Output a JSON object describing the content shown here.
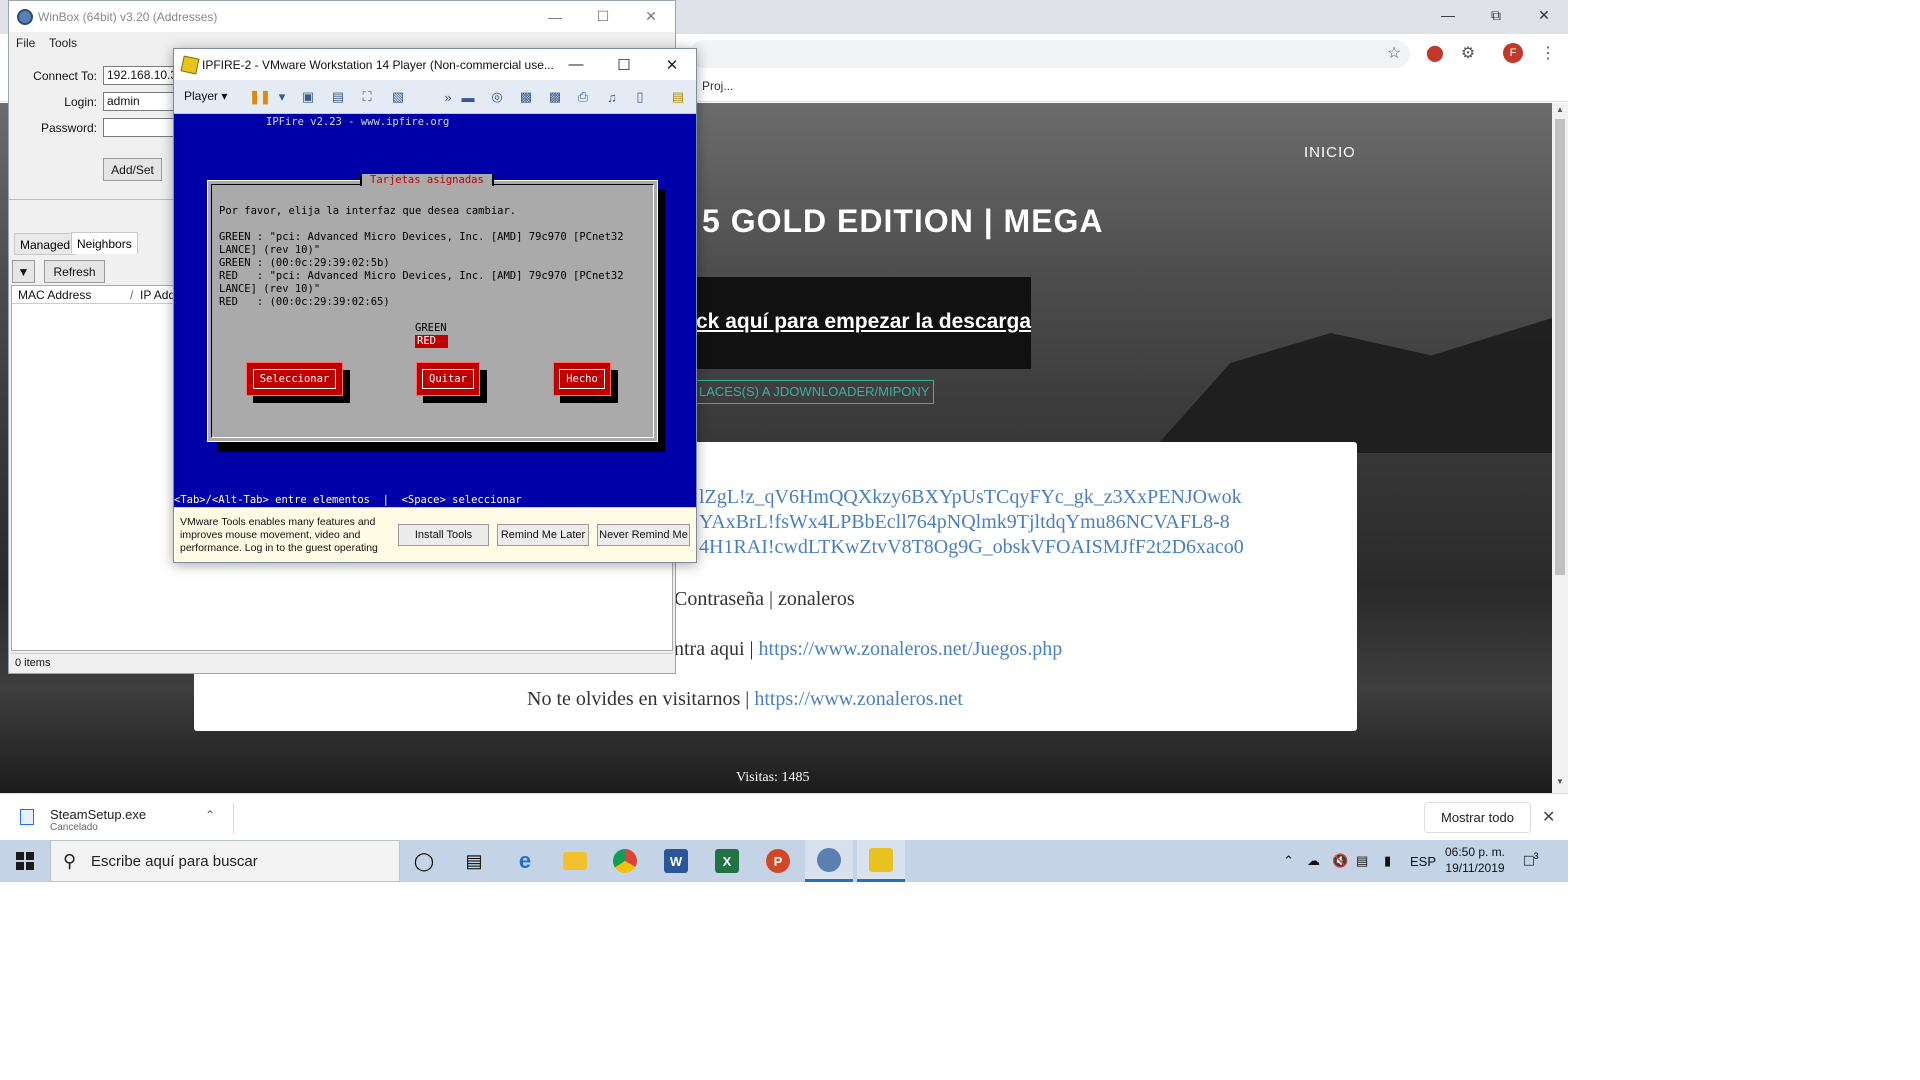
{
  "chrome": {
    "bookmark_label": "Proj...",
    "avatar_letter": "F",
    "ext_badge": "1",
    "page": {
      "nav_inicio": "INICIO",
      "title": "5 GOLD EDITION | MEGA",
      "download_button": "ck aquí para empezar la descarga",
      "enlaces_button": "LACES(S) A JDOWNLOADER/MIPONY",
      "links": [
        "lZgL!z_qV6HmQQXkzy6BXYpUsTCqyFYc_gk_z3XxPENJOwok",
        "YAxBrL!fsWx4LPBbEcll764pNQlmk9TjltdqYmu86NCVAFL8-8",
        "4H1RAI!cwdLTKwZtvV8T8Og9G_obskVFOAISMJfF2t2D6xaco0"
      ],
      "password_text": "Contraseña | zonaleros",
      "entra_prefix": "ntra aqui | ",
      "entra_link": "https://www.zonaleros.net/Juegos.php",
      "visit_prefix": "No te olvides en visitarnos | ",
      "visit_link": "https://www.zonaleros.net",
      "visitas": "Visitas: 1485"
    },
    "downloads": {
      "file_name": "SteamSetup.exe",
      "status": "Cancelado",
      "show_all": "Mostrar todo"
    }
  },
  "winbox": {
    "title": "WinBox (64bit) v3.20 (Addresses)",
    "menu": [
      "File",
      "Tools"
    ],
    "connect_to_label": "Connect To:",
    "connect_to_value": "192.168.10.3",
    "login_label": "Login:",
    "login_value": "admin",
    "password_label": "Password:",
    "password_value": "",
    "add_set_button": "Add/Set",
    "tabs": [
      "Managed",
      "Neighbors"
    ],
    "refresh_button": "Refresh",
    "columns": [
      "MAC Address",
      "IP Add"
    ],
    "status": "0 items"
  },
  "vmware": {
    "title": "IPFIRE-2 - VMware Workstation 14 Player (Non-commercial use...",
    "player_menu": "Player",
    "console": {
      "header": "IPFire v2.23 - www.ipfire.org",
      "dialog_title": "Tarjetas asignadas",
      "prompt": "Por favor, elija la interfaz que desea cambiar.",
      "lines": [
        "GREEN : \"pci: Advanced Micro Devices, Inc. [AMD] 79c970 [PCnet32",
        "LANCE] (rev 10)\"",
        "GREEN : (00:0c:29:39:02:5b)",
        "RED   : \"pci: Advanced Micro Devices, Inc. [AMD] 79c970 [PCnet32",
        "LANCE] (rev 10)\"",
        "RED   : (00:0c:29:39:02:65)"
      ],
      "option_green": "GREEN",
      "option_red": "RED",
      "buttons": [
        "Seleccionar",
        "Quitar",
        "Hecho"
      ],
      "footer": "<Tab>/<Alt-Tab> entre elementos  |  <Space> seleccionar"
    },
    "tools_bar": {
      "message": "VMware Tools enables many features and improves mouse movement, video and performance. Log in to the guest operating",
      "install": "Install Tools",
      "remind": "Remind Me Later",
      "never": "Never Remind Me"
    }
  },
  "taskbar": {
    "search_placeholder": "Escribe aquí para buscar",
    "language": "ESP",
    "time": "06:50 p. m.",
    "date": "19/11/2019",
    "notification_count": "3"
  }
}
